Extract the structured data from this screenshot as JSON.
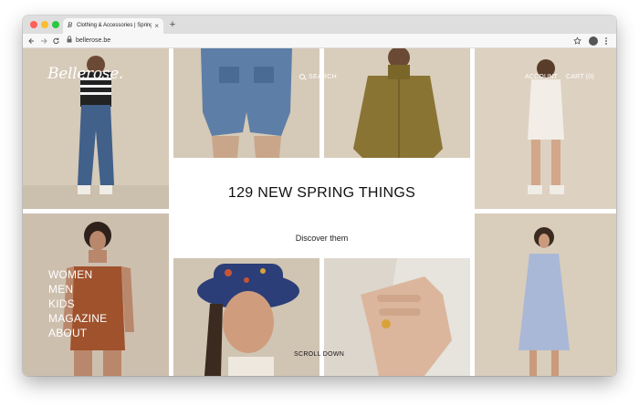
{
  "browser": {
    "tab_title": "Clothing & Accessories | Spring Summer",
    "tab_favicon": "B",
    "tab_close": "×",
    "new_tab": "+",
    "url": "bellerose.be",
    "icons": {
      "back": "back-arrow-icon",
      "forward": "forward-arrow-icon",
      "reload": "reload-icon",
      "lock": "lock-icon",
      "bookmark": "star-icon",
      "profile": "profile-icon",
      "menu": "kebab-menu-icon"
    }
  },
  "site": {
    "logo": "Bellerose.",
    "search_label": "SEARCH",
    "account_label": "ACCOUNT",
    "cart_label": "CART (0)",
    "menu": [
      "WOMEN",
      "MEN",
      "KIDS",
      "MAGAZINE",
      "ABOUT"
    ],
    "promo": {
      "title": "129 NEW SPRING THINGS",
      "link": "Discover them"
    },
    "scroll_label": "SCROLL DOWN"
  },
  "colors": {
    "tile_beige": "#d8ccbd",
    "tile_warm": "#cdbfae",
    "jacket_khaki": "#8a7434",
    "denim": "#41608a",
    "swimsuit_rust": "#a0522d",
    "dress_blue": "#a9b8d6",
    "hat_navy": "#2c3e78"
  }
}
